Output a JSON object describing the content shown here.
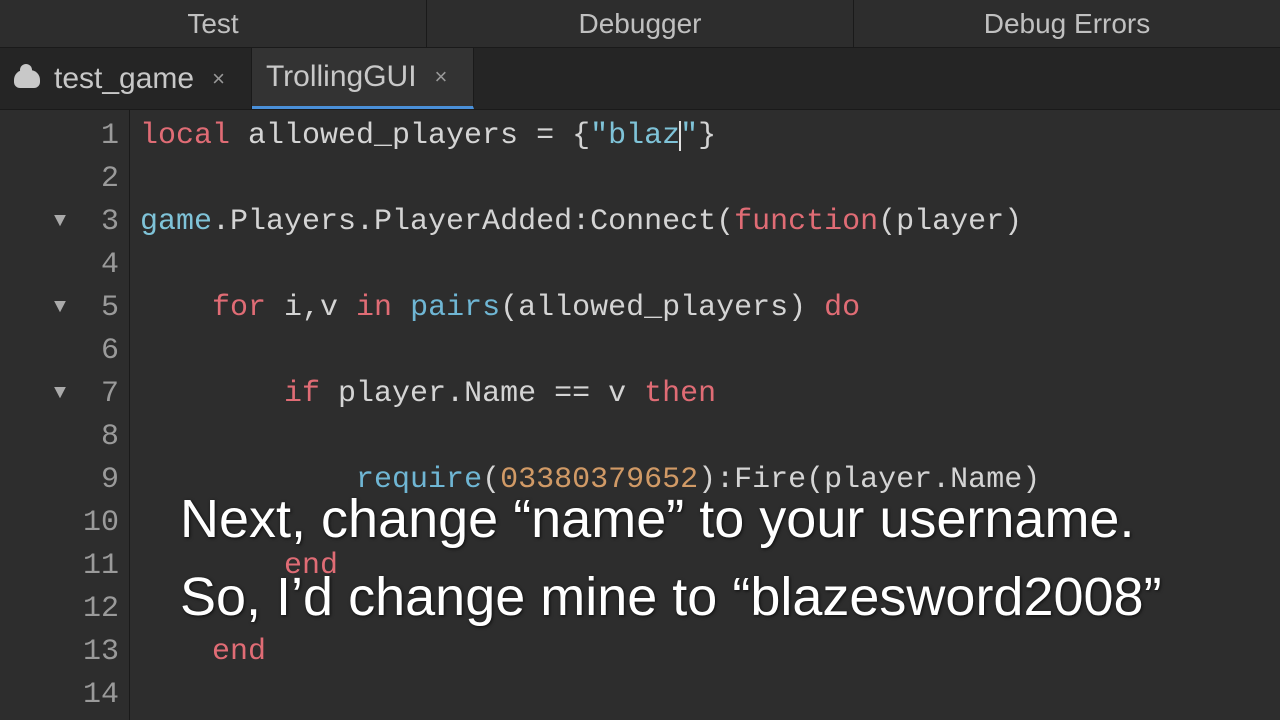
{
  "top_tabs": {
    "test": "Test",
    "debugger": "Debugger",
    "debug_errors": "Debug Errors"
  },
  "file_tabs": {
    "tab1": {
      "label": "test_game",
      "close": "×"
    },
    "tab2": {
      "label": "TrollingGUI",
      "close": "×"
    }
  },
  "gutter": [
    "1",
    "2",
    "3",
    "4",
    "5",
    "6",
    "7",
    "8",
    "9",
    "10",
    "11",
    "12",
    "13",
    "14"
  ],
  "code": {
    "l1": {
      "kw": "local",
      "rest": " allowed_players = {",
      "str": "\"blaz",
      "str2": "\"",
      "close": "}"
    },
    "l3": {
      "game": "game",
      "mid": ".Players.PlayerAdded:Connect(",
      "fn": "function",
      "args": "(player)"
    },
    "l5": {
      "pre": "    ",
      "for": "for",
      "mid": " i,v ",
      "in": "in",
      "sp": " ",
      "pairs": "pairs",
      "args": "(allowed_players) ",
      "do": "do"
    },
    "l7": {
      "pre": "        ",
      "if": "if",
      "mid": " player.Name == v ",
      "then": "then"
    },
    "l9": {
      "pre": "            ",
      "req": "require",
      "open": "(",
      "num": "03380379652",
      "rest": "):Fire(player.Name)"
    },
    "l11": {
      "pre": "        ",
      "end": "end"
    },
    "l13": {
      "pre": "    ",
      "end": "end"
    }
  },
  "overlay": "Next, change “name” to your username. So, I’d change mine to “blazesword2008”"
}
